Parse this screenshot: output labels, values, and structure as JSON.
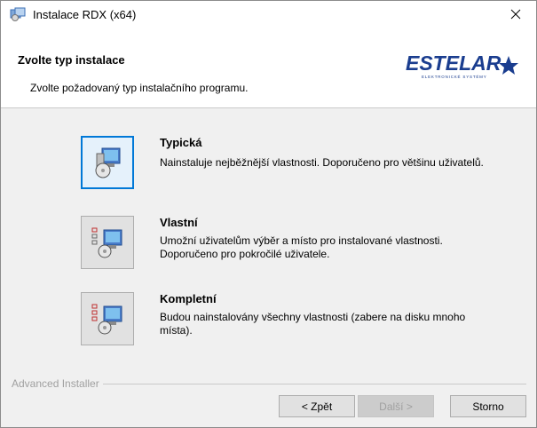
{
  "window": {
    "title": "Instalace RDX (x64)"
  },
  "header": {
    "title": "Zvolte typ instalace",
    "subtitle": "Zvolte požadovaný typ instalačního programu.",
    "logo_text": "ESTELAR",
    "logo_tagline": "ELEKTRONICKÉ SYSTÉMY"
  },
  "options": [
    {
      "title": "Typická",
      "description": "Nainstaluje nejběžnější vlastnosti. Doporučeno pro většinu uživatelů.",
      "selected": true
    },
    {
      "title": "Vlastní",
      "description": "Umožní uživatelům výběr a místo pro instalované vlastnosti. Doporučeno pro pokročilé uživatele.",
      "selected": false
    },
    {
      "title": "Kompletní",
      "description": "Budou nainstalovány všechny vlastnosti (zabere na disku mnoho místa).",
      "selected": false
    }
  ],
  "footer": {
    "brand": "Advanced Installer",
    "back_label": "< Zpět",
    "next_label": "Další >",
    "next_disabled": true,
    "cancel_label": "Storno"
  },
  "colors": {
    "logo_blue": "#1a3d8f",
    "selection_border": "#0078d7"
  }
}
